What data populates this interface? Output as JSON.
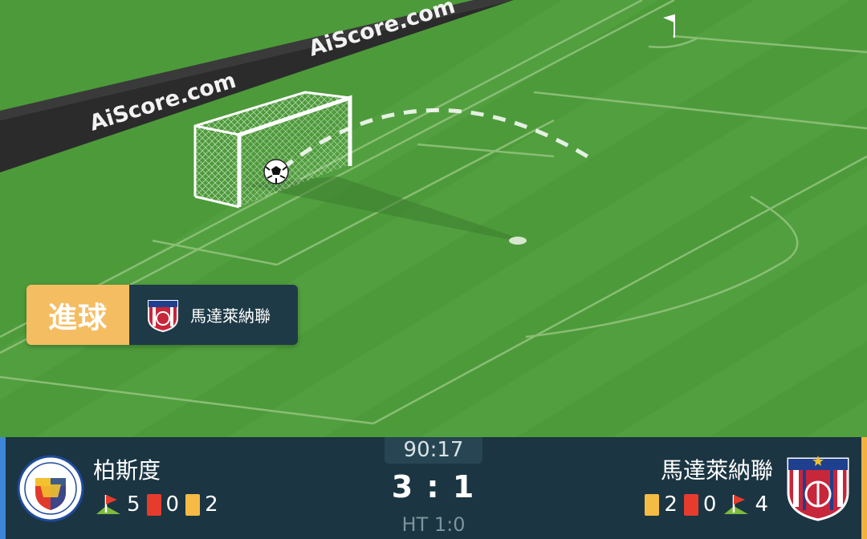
{
  "watermark": {
    "text_1": "AiScore.com",
    "text_2": "AiScore.com"
  },
  "event": {
    "type": "進球",
    "team_name": "馬達萊納聯"
  },
  "match": {
    "time": "90:17",
    "score": "3 : 1",
    "halftime": "HT 1:0"
  },
  "home": {
    "name": "柏斯度",
    "logo_icon": "deportivo-pasto-crest-icon",
    "corners": "5",
    "red_cards": "0",
    "yellow_cards": "2",
    "side_color": "#3d86d9"
  },
  "away": {
    "name": "馬達萊納聯",
    "logo_icon": "union-magdalena-crest-icon",
    "yellow_cards": "2",
    "red_cards": "0",
    "corners": "4",
    "side_color": "#f2b13f"
  },
  "colors": {
    "pitch": "#4d9a3a",
    "scoreboard": "#1b3542",
    "goal_badge": "#f5bd62",
    "red_card": "#e63c2e",
    "yellow_card": "#f5bb45"
  }
}
